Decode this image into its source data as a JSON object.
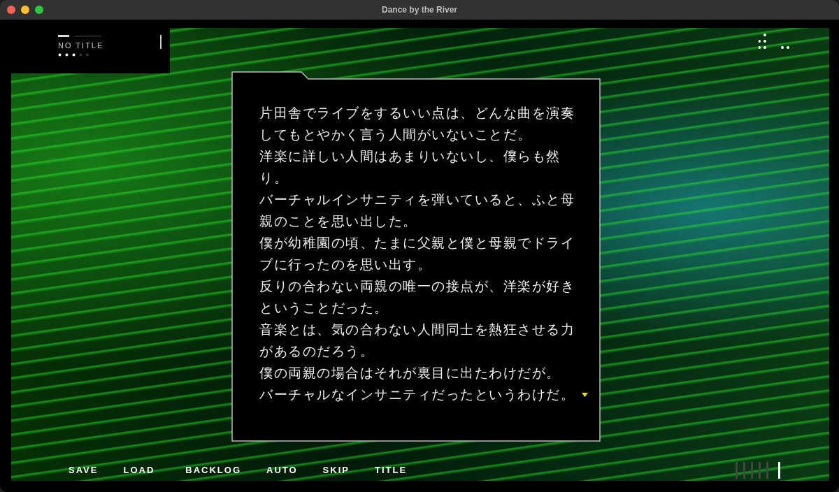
{
  "window": {
    "title": "Dance by the River"
  },
  "header": {
    "label": "NO TITLE"
  },
  "dialog": {
    "lines": [
      "片田舎でライブをするいい点は、どんな曲を演奏してもとやかく言う人間がいないことだ。",
      "洋楽に詳しい人間はあまりいないし、僕らも然り。",
      "バーチャルインサニティを弾いていると、ふと母親のことを思い出した。",
      "僕が幼稚園の頃、たまに父親と僕と母親でドライブに行ったのを思い出す。",
      "反りの合わない両親の唯一の接点が、洋楽が好きということだった。",
      "音楽とは、気の合わない人間同士を熱狂させる力があるのだろう。",
      "僕の両親の場合はそれが裏目に出たわけだが。",
      "バーチャルなインサニティだったというわけだ。"
    ]
  },
  "menu": [
    "SAVE",
    "LOAD",
    "BACKLOG",
    "AUTO",
    "SKIP",
    "TITLE"
  ]
}
